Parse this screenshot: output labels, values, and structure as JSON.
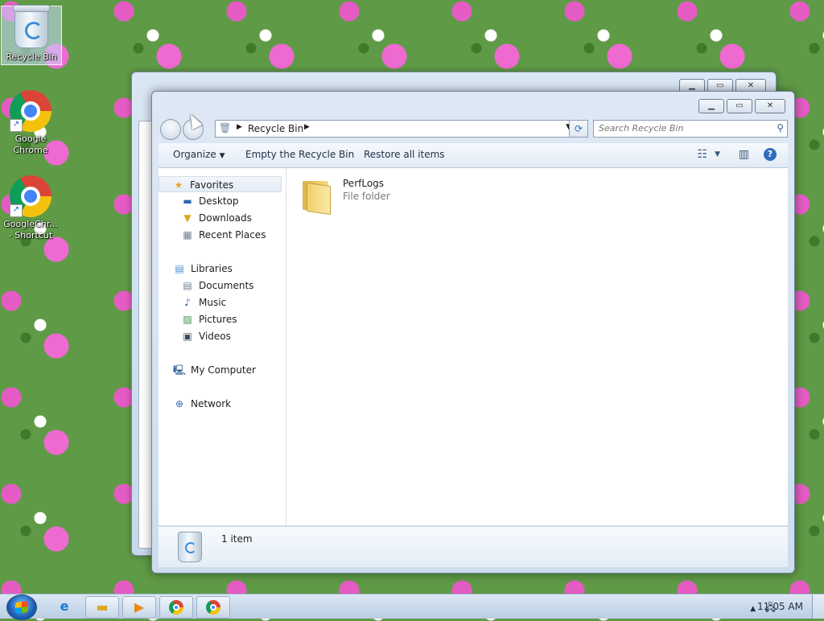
{
  "desktop": {
    "icons": [
      {
        "label": "Recycle Bin"
      },
      {
        "label": "Google Chrome"
      },
      {
        "label": "GoogleChr... - Shortcut"
      }
    ]
  },
  "window": {
    "address": {
      "crumb": "Recycle Bin"
    },
    "search": {
      "placeholder": "Search Recycle Bin"
    },
    "toolbar": {
      "organize_label": "Organize",
      "empty_label": "Empty the Recycle Bin",
      "restore_label": "Restore all items"
    },
    "nav": {
      "favorites_header": "Favorites",
      "favorites": [
        "Desktop",
        "Downloads",
        "Recent Places"
      ],
      "libraries_header": "Libraries",
      "libraries": [
        "Documents",
        "Music",
        "Pictures",
        "Videos"
      ],
      "computer": "My Computer",
      "network": "Network"
    },
    "items": [
      {
        "name": "PerfLogs",
        "type": "File folder",
        "icon": "folder-icon"
      }
    ],
    "details": {
      "count": "1 item"
    }
  },
  "taskbar": {
    "clock": "11:05 AM",
    "apps": [
      "internet-explorer-icon",
      "explorer-icon",
      "media-player-icon",
      "chrome-icon",
      "chrome-icon"
    ]
  }
}
